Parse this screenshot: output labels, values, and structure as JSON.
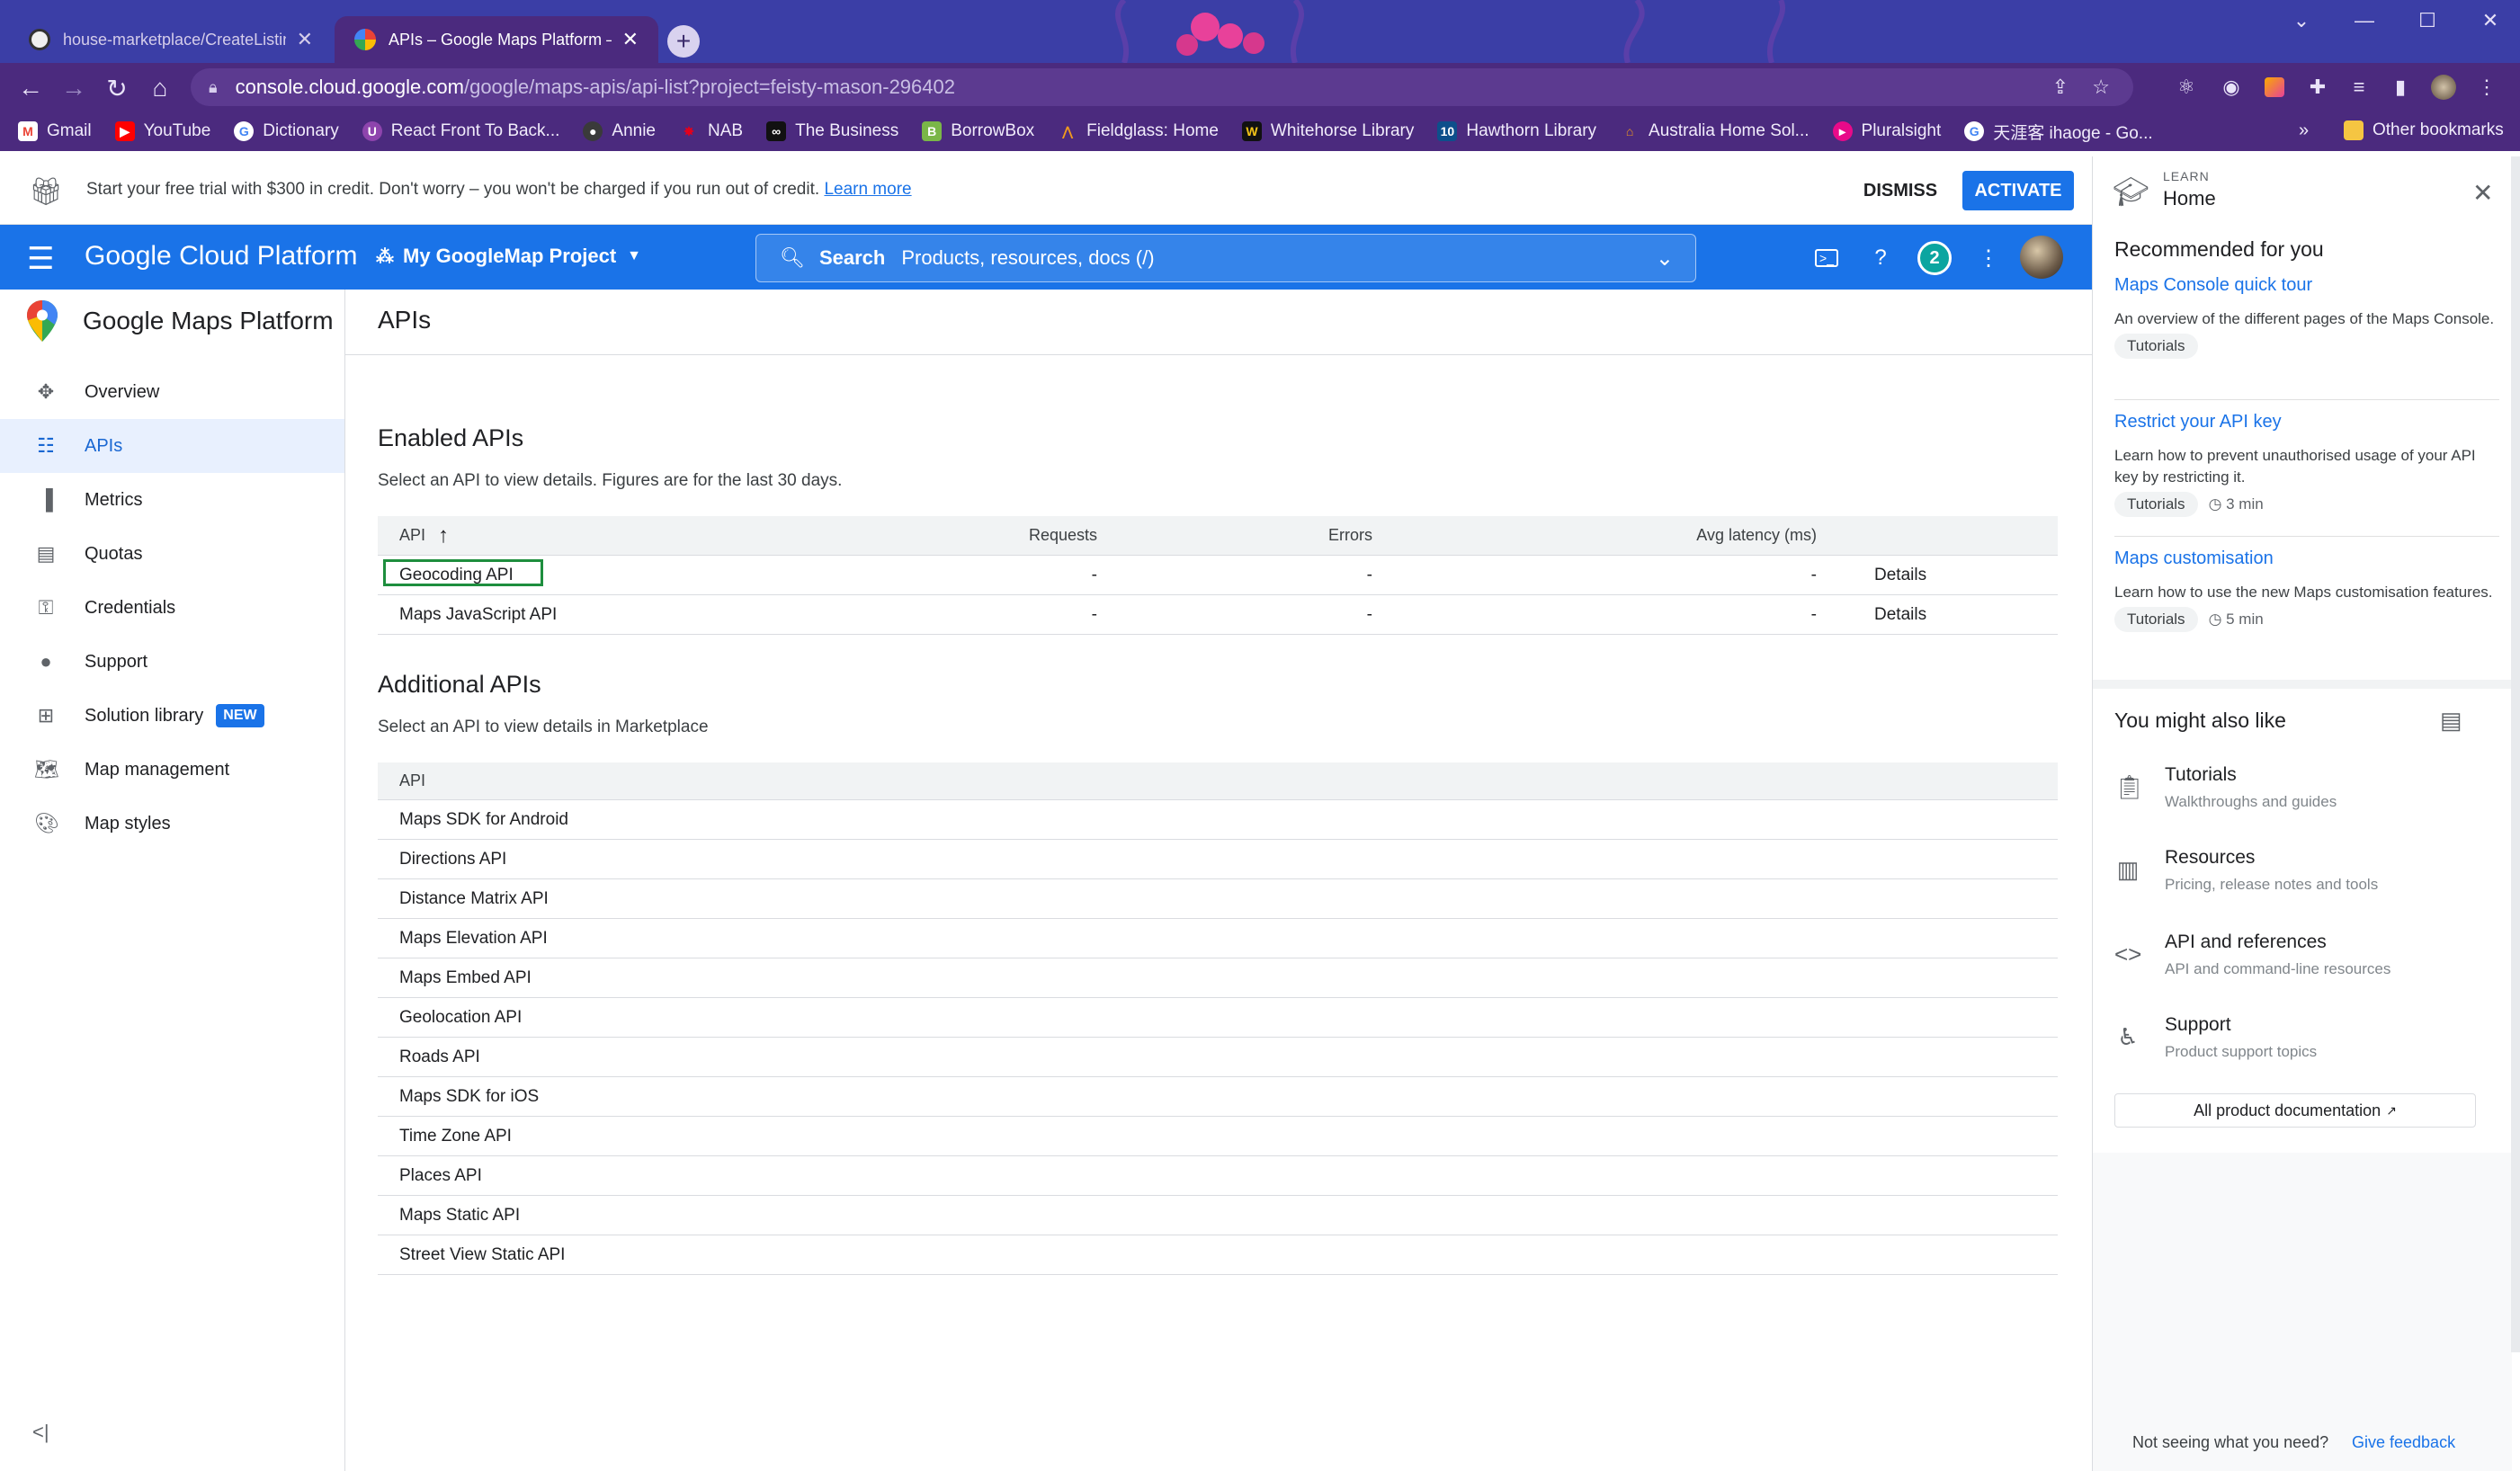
{
  "browser": {
    "tabs": [
      {
        "title": "house-marketplace/CreateListing.",
        "active": false,
        "favicon": "github-icon"
      },
      {
        "title": "APIs – Google Maps Platform – M",
        "active": true,
        "favicon": "maps-pin-icon"
      }
    ],
    "url_host": "console.cloud.google.com",
    "url_path": "/google/maps-apis/api-list?project=feisty-mason-296402",
    "bookmarks": [
      "Gmail",
      "YouTube",
      "Dictionary",
      "React Front To Back...",
      "Annie",
      "NAB",
      "The Business",
      "BorrowBox",
      "Fieldglass: Home",
      "Whitehorse Library",
      "Hawthorn Library",
      "Australia Home Sol...",
      "Pluralsight",
      "天涯客 ihaoge - Go..."
    ],
    "bookmarks_overflow": "»",
    "other_bookmarks": "Other bookmarks"
  },
  "banner": {
    "message": "Start your free trial with $300 in credit. Don't worry – you won't be charged if you run out of credit.",
    "link": "Learn more",
    "dismiss": "DISMISS",
    "activate": "ACTIVATE"
  },
  "header": {
    "brand": "Google Cloud Platform",
    "project": "My GoogleMap Project",
    "search_label": "Search",
    "search_hint": "Products, resources, docs (/)",
    "notifications": "2"
  },
  "sidebar": {
    "product": "Google Maps Platform",
    "items": [
      {
        "label": "Overview",
        "icon": "overview-icon"
      },
      {
        "label": "APIs",
        "icon": "list-icon",
        "active": true
      },
      {
        "label": "Metrics",
        "icon": "bar-chart-icon"
      },
      {
        "label": "Quotas",
        "icon": "quota-icon"
      },
      {
        "label": "Credentials",
        "icon": "key-icon"
      },
      {
        "label": "Support",
        "icon": "person-icon"
      },
      {
        "label": "Solution library",
        "icon": "grid-icon",
        "badge": "NEW"
      },
      {
        "label": "Map management",
        "icon": "map-icon"
      },
      {
        "label": "Map styles",
        "icon": "palette-icon"
      }
    ]
  },
  "main": {
    "title": "APIs",
    "enabled": {
      "heading": "Enabled APIs",
      "subtitle": "Select an API to view details. Figures are for the last 30 days.",
      "columns": [
        "API",
        "Requests",
        "Errors",
        "Avg latency (ms)"
      ],
      "rows": [
        {
          "name": "Geocoding API",
          "requests": "-",
          "errors": "-",
          "latency": "-",
          "action": "Details"
        },
        {
          "name": "Maps JavaScript API",
          "requests": "-",
          "errors": "-",
          "latency": "-",
          "action": "Details"
        }
      ]
    },
    "additional": {
      "heading": "Additional APIs",
      "subtitle": "Select an API to view details in Marketplace",
      "column": "API",
      "rows": [
        "Maps SDK for Android",
        "Directions API",
        "Distance Matrix API",
        "Maps Elevation API",
        "Maps Embed API",
        "Geolocation API",
        "Roads API",
        "Maps SDK for iOS",
        "Time Zone API",
        "Places API",
        "Maps Static API",
        "Street View Static API"
      ]
    }
  },
  "learn": {
    "eyebrow": "LEARN",
    "title": "Home",
    "recommended_heading": "Recommended for you",
    "recommended": [
      {
        "title": "Maps Console quick tour",
        "desc": "An overview of the different pages of the Maps Console.",
        "chip": "Tutorials",
        "duration": ""
      },
      {
        "title": "Restrict your API key",
        "desc": "Learn how to prevent unauthorised usage of your API key by restricting it.",
        "chip": "Tutorials",
        "duration": "3 min"
      },
      {
        "title": "Maps customisation",
        "desc": "Learn how to use the new Maps customisation features.",
        "chip": "Tutorials",
        "duration": "5 min"
      }
    ],
    "also_like_heading": "You might also like",
    "also_like": [
      {
        "title": "Tutorials",
        "sub": "Walkthroughs and guides",
        "icon": "clipboard-icon"
      },
      {
        "title": "Resources",
        "sub": "Pricing, release notes and tools",
        "icon": "library-icon"
      },
      {
        "title": "API and references",
        "sub": "API and command-line resources",
        "icon": "code-icon"
      },
      {
        "title": "Support",
        "sub": "Product support topics",
        "icon": "accessibility-icon"
      }
    ],
    "all_docs": "All product documentation",
    "footer_q": "Not seeing what you need?",
    "footer_link": "Give feedback"
  },
  "colors": {
    "accent": "#1a73e8",
    "chrome_frame": "#4b2a7e",
    "highlight": "#1e8e3e"
  }
}
